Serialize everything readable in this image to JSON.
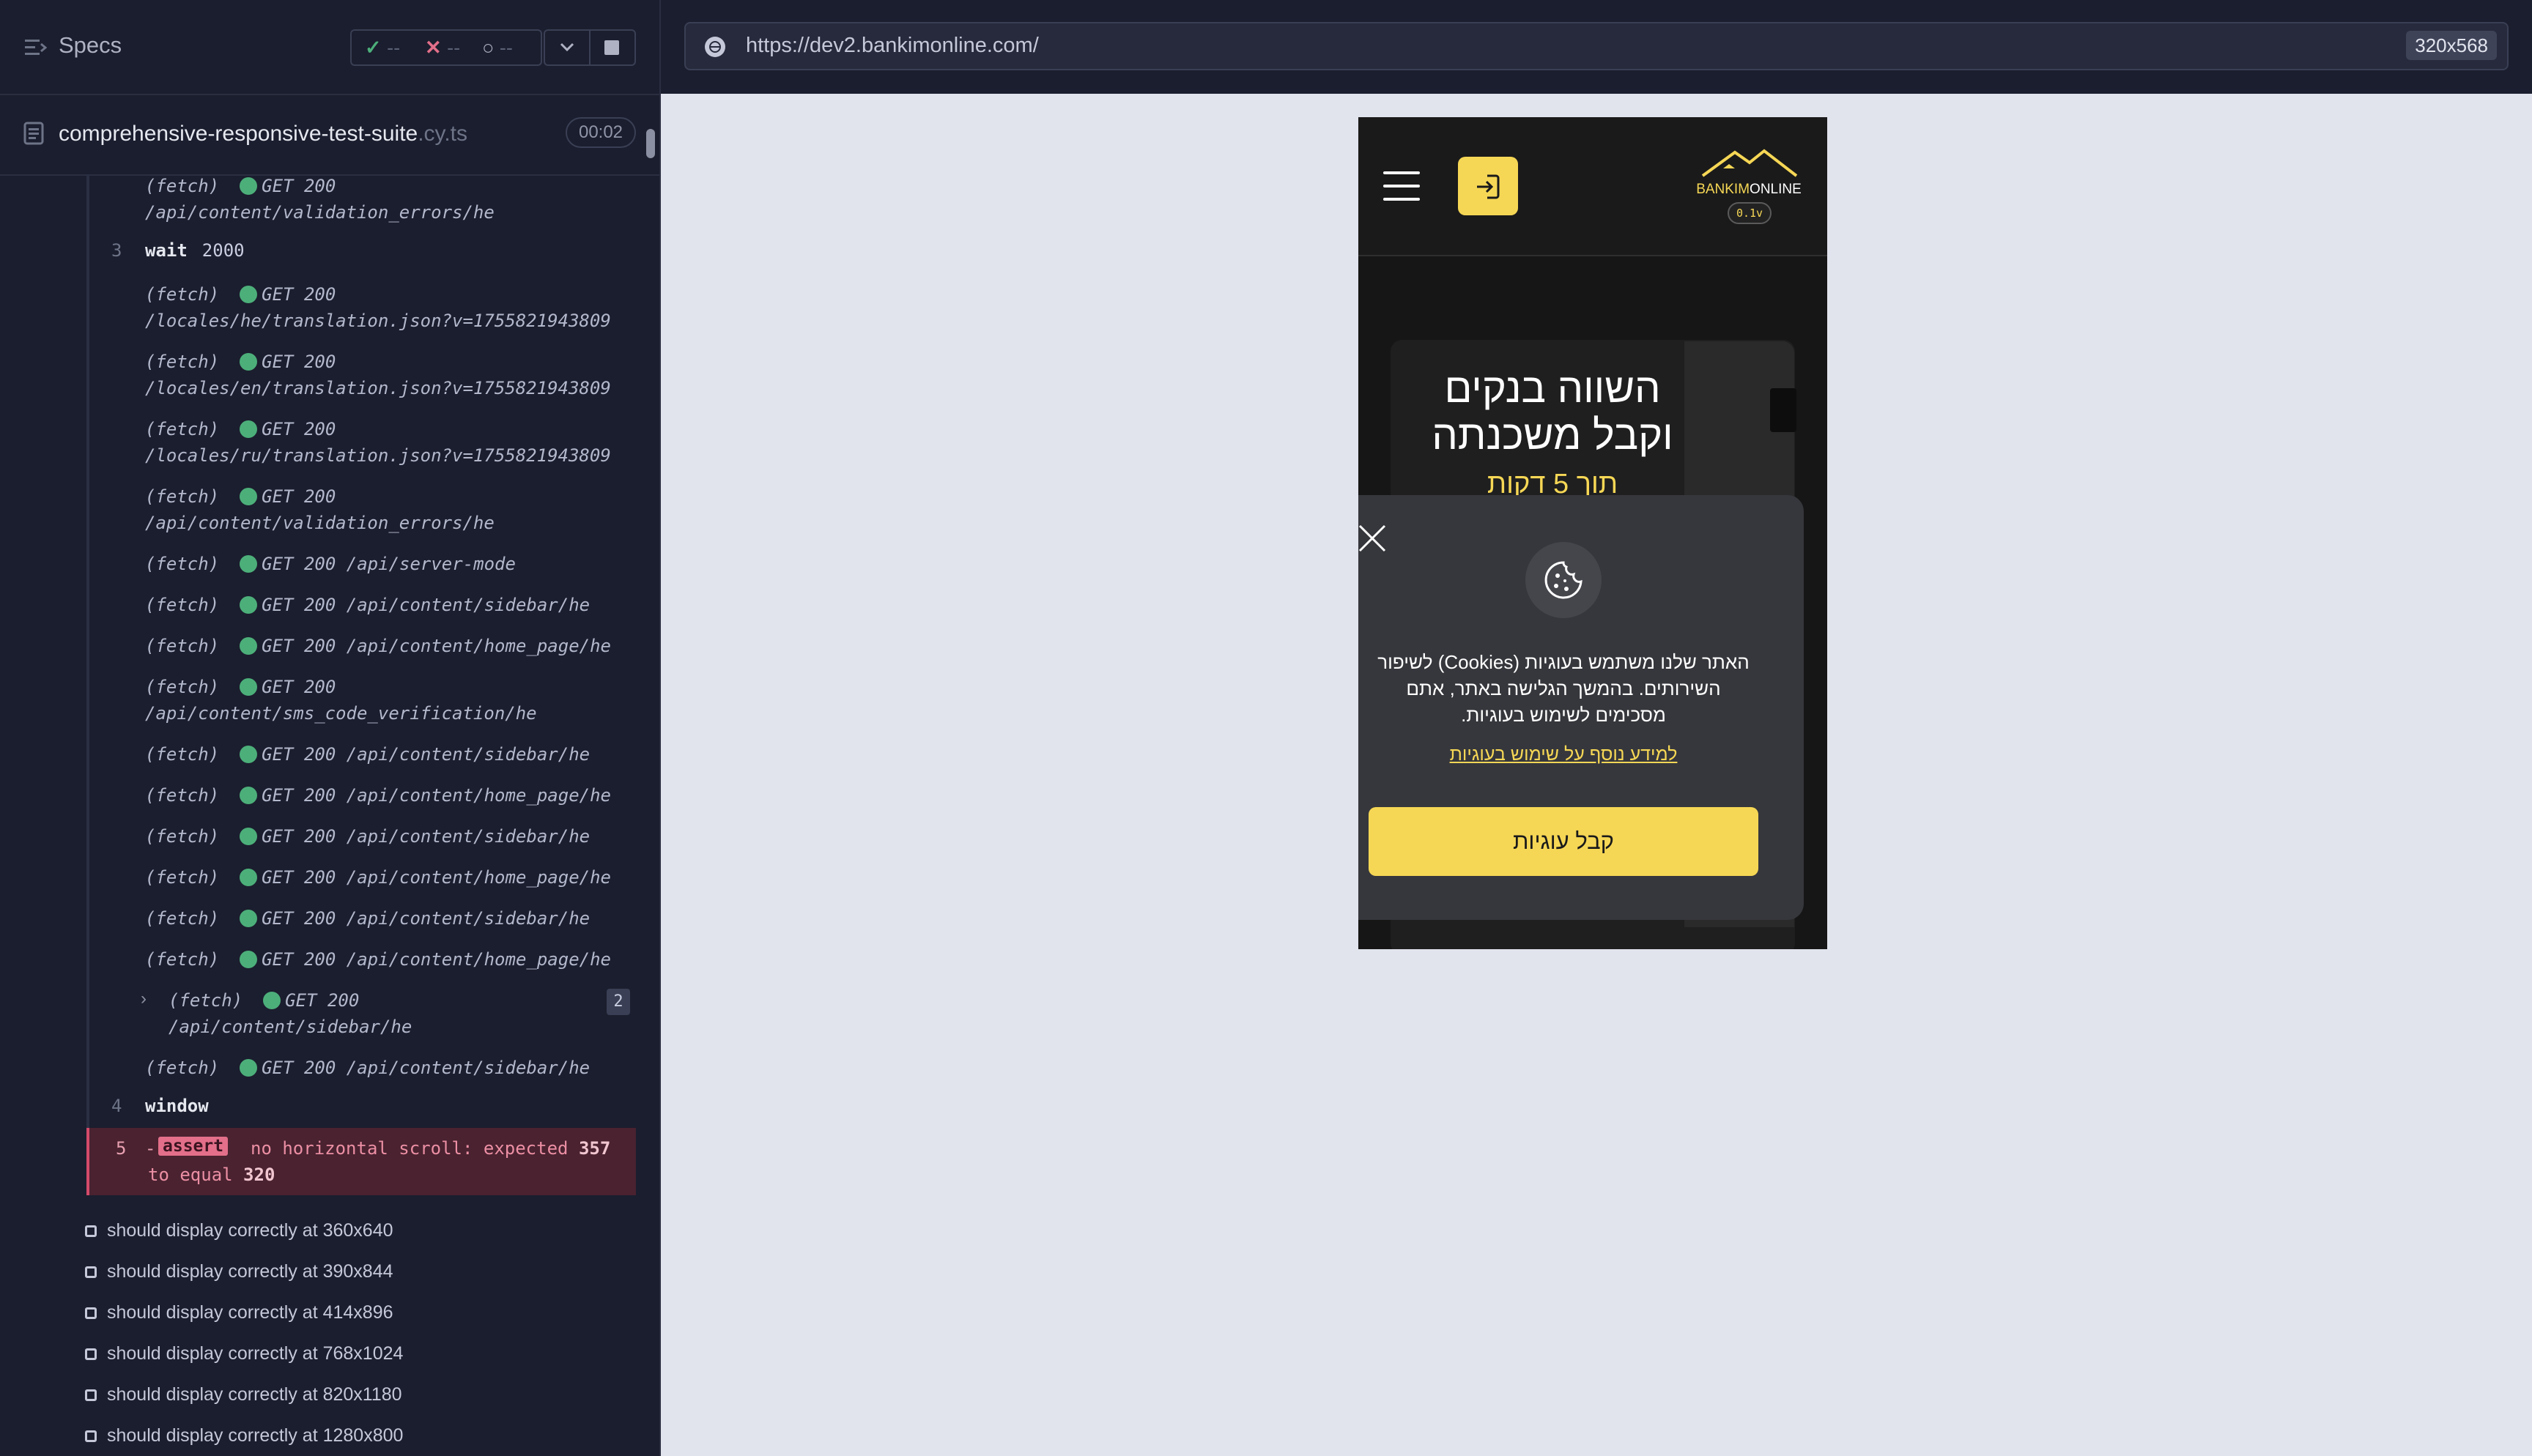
{
  "reporter": {
    "specs_title": "Specs",
    "stats": {
      "passed": "--",
      "failed": "--",
      "pending": "--"
    },
    "file": {
      "name": "comprehensive-responsive-test-suite",
      "ext": ".cy.ts",
      "duration": "00:02"
    },
    "commands": [
      {
        "label": "(fetch)",
        "method": "GET 200",
        "url": "",
        "url2": "/api/content/validation_errors/he"
      },
      {
        "num": "3",
        "name": "wait",
        "arg": "2000"
      },
      {
        "label": "(fetch)",
        "method": "GET 200",
        "url": "",
        "url2": "/locales/he/translation.json?v=1755821943809"
      },
      {
        "label": "(fetch)",
        "method": "GET 200",
        "url": "",
        "url2": "/locales/en/translation.json?v=1755821943809"
      },
      {
        "label": "(fetch)",
        "method": "GET 200",
        "url": "",
        "url2": "/locales/ru/translation.json?v=1755821943809"
      },
      {
        "label": "(fetch)",
        "method": "GET 200",
        "url": "",
        "url2": "/api/content/validation_errors/he"
      },
      {
        "label": "(fetch)",
        "method": "GET 200",
        "url": "/api/server-mode"
      },
      {
        "label": "(fetch)",
        "method": "GET 200",
        "url": "/api/content/sidebar/he"
      },
      {
        "label": "(fetch)",
        "method": "GET 200",
        "url": "/api/content/home_page/he"
      },
      {
        "label": "(fetch)",
        "method": "GET 200",
        "url": "",
        "url2": "/api/content/sms_code_verification/he"
      },
      {
        "label": "(fetch)",
        "method": "GET 200",
        "url": "/api/content/sidebar/he"
      },
      {
        "label": "(fetch)",
        "method": "GET 200",
        "url": "/api/content/home_page/he"
      },
      {
        "label": "(fetch)",
        "method": "GET 200",
        "url": "/api/content/sidebar/he"
      },
      {
        "label": "(fetch)",
        "method": "GET 200",
        "url": "/api/content/home_page/he"
      },
      {
        "label": "(fetch)",
        "method": "GET 200",
        "url": "/api/content/sidebar/he"
      },
      {
        "label": "(fetch)",
        "method": "GET 200",
        "url": "/api/content/home_page/he"
      },
      {
        "label": "(fetch)",
        "method": "GET 200",
        "url": "",
        "url2": "/api/content/sidebar/he",
        "count": "2"
      },
      {
        "label": "(fetch)",
        "method": "GET 200",
        "url": "/api/content/sidebar/he"
      },
      {
        "num": "4",
        "name": "window",
        "arg": ""
      }
    ],
    "assert": {
      "num": "5",
      "dash": "-",
      "keyword": "assert",
      "msg_before": "no horizontal scroll: expected",
      "expected": "357",
      "msg_mid": "to equal",
      "actual": "320"
    },
    "tests": [
      "should display correctly at 360x640",
      "should display correctly at 390x844",
      "should display correctly at 414x896",
      "should display correctly at 768x1024",
      "should display correctly at 820x1180",
      "should display correctly at 1280x800"
    ]
  },
  "browser": {
    "url": "https://dev2.bankimonline.com/",
    "viewport": "320x568"
  },
  "app": {
    "logo_part1": "BANKIM",
    "logo_part2": "ONLINE",
    "version": "0.1v",
    "hero_title_line1": "השווה בנקים",
    "hero_title_line2": "וקבל משכנתה",
    "hero_subtitle": "תוך 5 דקות",
    "cookie_text": "האתר שלנו משתמש בעוגיות (Cookies) לשיפור השירותים. בהמשך הגלישה באתר, אתם מסכימים לשימוש בעוגיות.",
    "cookie_link": "למידע נוסף על שימוש בעוגיות",
    "cookie_accept": "קבל עוגיות"
  },
  "colors": {
    "accent_yellow": "#f6d755",
    "reporter_bg": "#1b1e2e",
    "success_green": "#4caf7a",
    "error_red": "#e36f8a"
  }
}
